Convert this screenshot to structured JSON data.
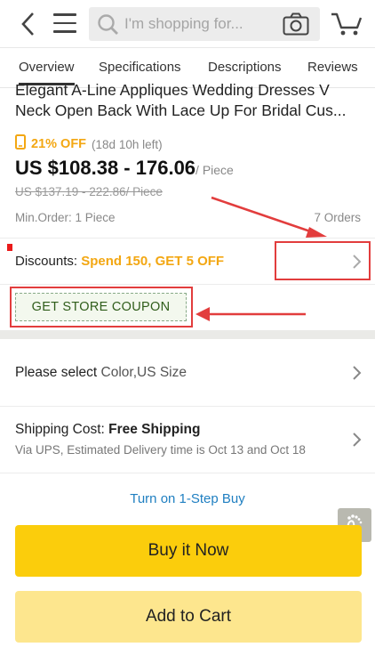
{
  "search": {
    "placeholder": "I'm shopping for..."
  },
  "tabs": [
    {
      "label": "Overview",
      "active": true
    },
    {
      "label": "Specifications"
    },
    {
      "label": "Descriptions"
    },
    {
      "label": "Reviews"
    }
  ],
  "product": {
    "title_line1": "Elegant A-Line Appliques Wedding Dresses V",
    "title_line2": "Neck Open Back With Lace Up For Bridal Cus...",
    "promo_off": "21% OFF",
    "promo_time": "(18d 10h left)",
    "price": "US $108.38 - 176.06",
    "price_unit": "/ Piece",
    "old_price": "US $137.19 - 222.86/ Piece",
    "min_order": "Min.Order: 1  Piece",
    "orders": "7 Orders"
  },
  "discounts": {
    "label": "Discounts:",
    "value": "Spend 150, GET 5 OFF"
  },
  "coupon": {
    "label": "GET STORE COUPON"
  },
  "select": {
    "label": "Please select",
    "value": "Color,US Size"
  },
  "shipping": {
    "label": "Shipping Cost:",
    "value": "Free Shipping",
    "detail": "Via UPS, Estimated Delivery time is Oct 13 and Oct 18"
  },
  "one_step": "Turn on 1-Step Buy",
  "buttons": {
    "buy_now": "Buy it Now",
    "add_to_cart": "Add to Cart"
  },
  "colors": {
    "accent_orange": "#f3a712",
    "buy_yellow": "#fbcd0c",
    "cart_yellow": "#fde68e",
    "link_blue": "#1f7fc1",
    "annotation_red": "#e23d3d"
  }
}
